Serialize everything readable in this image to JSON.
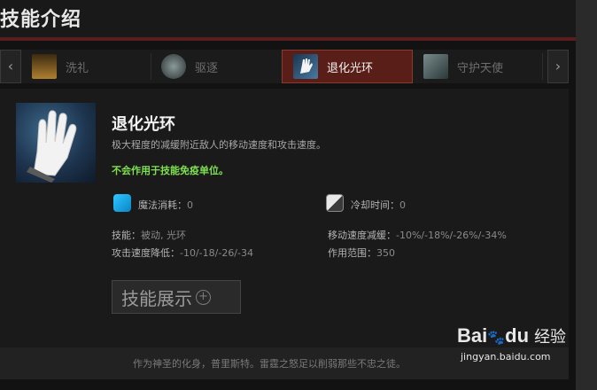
{
  "header": {
    "title": "技能介绍"
  },
  "tabs": {
    "prev_label": "‹",
    "next_label": "›",
    "items": [
      {
        "label": "洗礼",
        "icon": "baptism-icon",
        "color": "#8a6a2a"
      },
      {
        "label": "驱逐",
        "icon": "exile-icon",
        "color": "#5a6a6a"
      },
      {
        "label": "退化光环",
        "icon": "degen-aura-icon",
        "color": "#2a4a6a"
      },
      {
        "label": "守护天使",
        "icon": "guardian-angel-icon",
        "color": "#4a5a5a"
      }
    ],
    "active_index": 2
  },
  "skill": {
    "name": "退化光环",
    "description": "极大程度的减缓附近敌人的移动速度和攻击速度。",
    "note": "不会作用于技能免疫单位。",
    "mana_label": "魔法消耗：",
    "mana_value": "0",
    "cooldown_label": "冷却时间：",
    "cooldown_value": "0",
    "type_label": "技能：",
    "type_value": "被动, 光环",
    "move_slow_label": "移动速度减缓：",
    "move_slow_value": "-10%/-18%/-26%/-34%",
    "attack_slow_label": "攻击速度降低：",
    "attack_slow_value": "-10/-18/-26/-34",
    "range_label": "作用范围：",
    "range_value": "350",
    "showcase_label": "技能展示",
    "lore": "作为神圣的化身，普里斯特。雷霆之怒足以削弱那些不忠之徒。"
  },
  "watermark": {
    "logo": "Bai",
    "logo2": "du",
    "cn": "经验",
    "url": "jingyan.baidu.com"
  },
  "colors": {
    "accent_red": "#5a1e18",
    "note_green": "#7ee04e",
    "mana_blue": "#2ec8ff"
  }
}
